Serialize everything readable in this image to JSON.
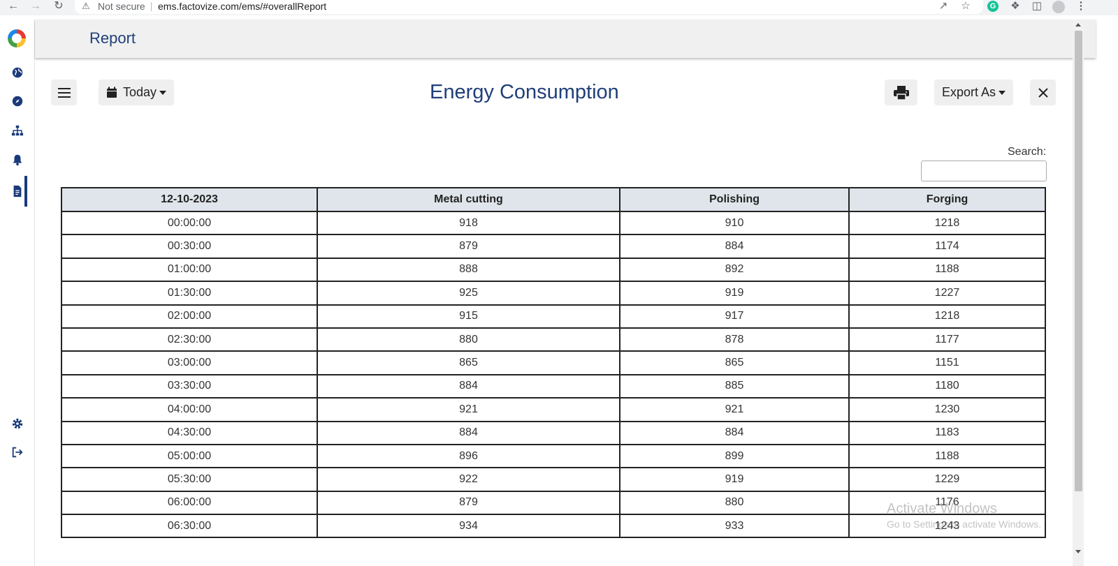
{
  "browser": {
    "security_label": "Not secure",
    "url": "ems.factovize.com/ems/#overallReport"
  },
  "app": {
    "header_title": "Report"
  },
  "sidebar": {
    "items": [
      {
        "icon": "globe-icon"
      },
      {
        "icon": "compass-icon"
      },
      {
        "icon": "sitemap-icon"
      },
      {
        "icon": "bell-icon"
      },
      {
        "icon": "file-report-icon",
        "active": true
      },
      {
        "icon": "gear-icon"
      },
      {
        "icon": "logout-icon"
      }
    ]
  },
  "toolbar": {
    "date_range": "Today",
    "title": "Energy Consumption",
    "export_label": "Export As"
  },
  "search": {
    "label": "Search:",
    "value": ""
  },
  "table": {
    "headers": [
      "12-10-2023",
      "Metal cutting",
      "Polishing",
      "Forging"
    ],
    "rows": [
      [
        "00:00:00",
        "918",
        "910",
        "1218"
      ],
      [
        "00:30:00",
        "879",
        "884",
        "1174"
      ],
      [
        "01:00:00",
        "888",
        "892",
        "1188"
      ],
      [
        "01:30:00",
        "925",
        "919",
        "1227"
      ],
      [
        "02:00:00",
        "915",
        "917",
        "1218"
      ],
      [
        "02:30:00",
        "880",
        "878",
        "1177"
      ],
      [
        "03:00:00",
        "865",
        "865",
        "1151"
      ],
      [
        "03:30:00",
        "884",
        "885",
        "1180"
      ],
      [
        "04:00:00",
        "921",
        "921",
        "1230"
      ],
      [
        "04:30:00",
        "884",
        "884",
        "1183"
      ],
      [
        "05:00:00",
        "896",
        "899",
        "1188"
      ],
      [
        "05:30:00",
        "922",
        "919",
        "1229"
      ],
      [
        "06:00:00",
        "879",
        "880",
        "1176"
      ],
      [
        "06:30:00",
        "934",
        "933",
        "1243"
      ]
    ]
  },
  "watermark": {
    "line1": "Activate Windows",
    "line2": "Go to Settings to activate Windows."
  }
}
